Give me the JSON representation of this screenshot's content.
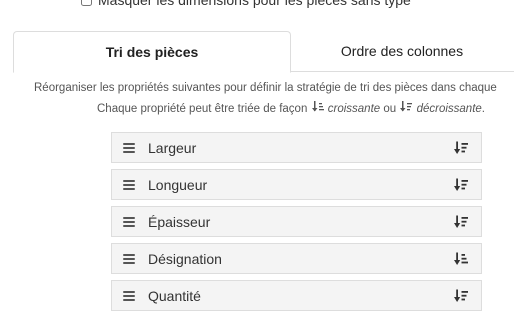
{
  "options": {
    "hide_dimensions_label": "Masquer les dimensions pour les pièces sans type",
    "hide_dimensions_checked": false
  },
  "tabs": [
    {
      "label": "Tri des pièces",
      "active": true
    },
    {
      "label": "Ordre des colonnes",
      "active": false
    }
  ],
  "help": {
    "line1": "Réorganiser les propriétés suivantes pour définir la stratégie de tri des pièces dans chaque",
    "line2_prefix": "Chaque propriété peut être triée de façon",
    "ascending": "croissante",
    "or": "ou",
    "descending": "décroissante",
    "period": "."
  },
  "properties": [
    {
      "label": "Largeur",
      "sort": "descending",
      "sort_icon": "sort-descending-icon"
    },
    {
      "label": "Longueur",
      "sort": "descending",
      "sort_icon": "sort-descending-icon"
    },
    {
      "label": "Épaisseur",
      "sort": "descending",
      "sort_icon": "sort-descending-icon"
    },
    {
      "label": "Désignation",
      "sort": "ascending",
      "sort_icon": "sort-ascending-icon"
    },
    {
      "label": "Quantité",
      "sort": "descending",
      "sort_icon": "sort-descending-icon"
    }
  ]
}
